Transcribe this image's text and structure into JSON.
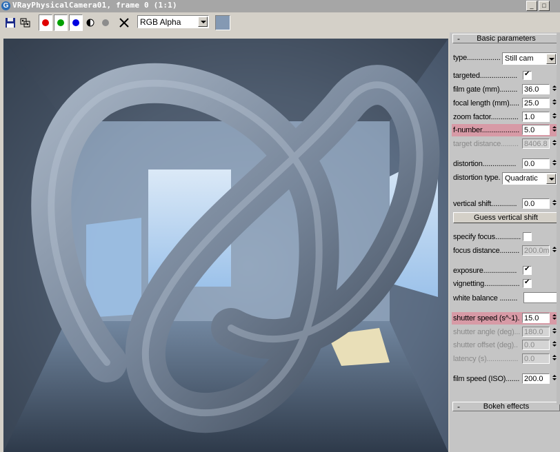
{
  "window": {
    "title": "VRayPhysicalCamera01, frame 0 (1:1)",
    "icon": "vray-app-icon"
  },
  "toolbar": {
    "icons": [
      "save-icon",
      "clone-icon",
      "red-channel-icon",
      "green-channel-icon",
      "blue-channel-icon",
      "alpha-toggle-icon",
      "mono-icon",
      "clear-icon"
    ],
    "channel_select": "RGB Alpha",
    "swatch_color": "#8499b3"
  },
  "panel": {
    "basic_title": "Basic parameters",
    "bokeh_title": "Bokeh effects",
    "highlight_color": "#d79aa6",
    "type_label": "type.................",
    "type_value": "Still cam",
    "targeted_label": "targeted...................",
    "targeted_checked": true,
    "film_gate_label": "film gate (mm).........",
    "film_gate_value": "36.0",
    "focal_length_label": "focal length (mm).....",
    "focal_length_value": "25.0",
    "zoom_factor_label": "zoom factor..............",
    "zoom_factor_value": "1.0",
    "f_number_label": "f-number...................",
    "f_number_value": "5.0",
    "target_distance_label": "target distance.........",
    "target_distance_value": "8406.8",
    "distortion_label": "distortion.................",
    "distortion_value": "0.0",
    "distortion_type_label": "distortion type.",
    "distortion_type_value": "Quadratic",
    "vertical_shift_label": "vertical shift.............",
    "vertical_shift_value": "0.0",
    "guess_button": "Guess vertical shift",
    "specify_focus_label": "specify focus.............",
    "specify_focus_checked": false,
    "focus_distance_label": "focus distance..........",
    "focus_distance_value": "200.0m",
    "exposure_label": "exposure.................",
    "exposure_checked": true,
    "vignetting_label": "vignetting..................",
    "vignetting_checked": true,
    "white_balance_label": "white balance .........",
    "white_balance_color": "#ffffff",
    "shutter_speed_label": "shutter speed (s^-1).",
    "shutter_speed_value": "15.0",
    "shutter_angle_label": "shutter angle (deg)...",
    "shutter_angle_value": "180.0",
    "shutter_offset_label": "shutter offset (deg)..",
    "shutter_offset_value": "0.0",
    "latency_label": "latency (s)................",
    "latency_value": "0.0",
    "film_speed_label": "film speed (ISO).......",
    "film_speed_value": "200.0"
  }
}
